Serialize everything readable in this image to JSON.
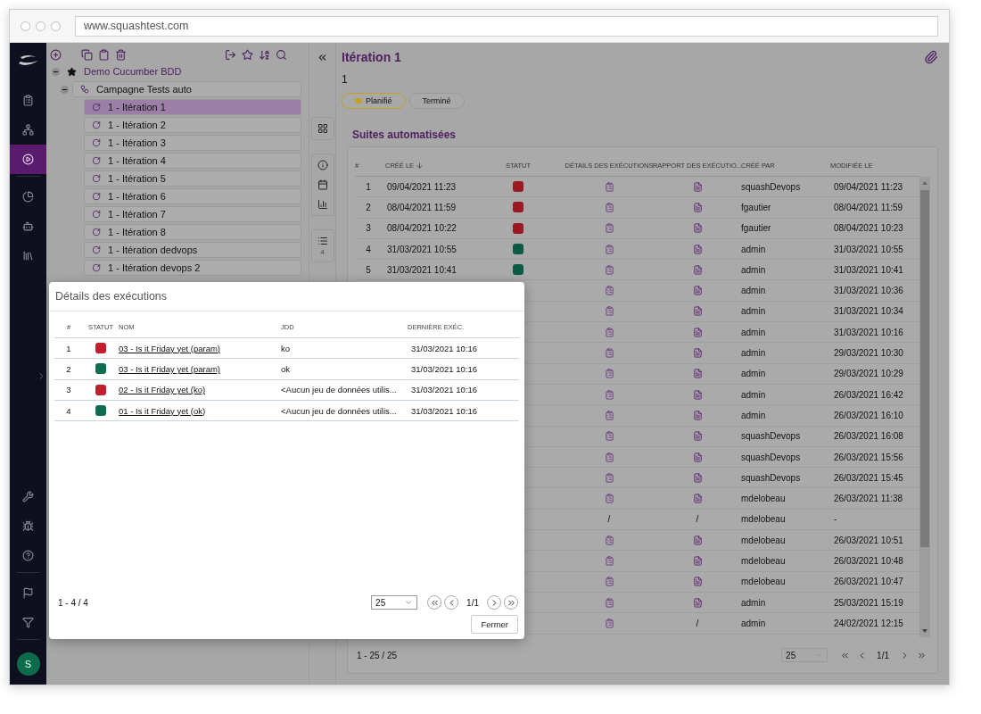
{
  "browser": {
    "url": "www.squashtest.com"
  },
  "nav": {
    "items": [
      {
        "selected": false
      },
      {
        "selected": false
      },
      {
        "selected": true
      },
      {
        "selected": false
      },
      {
        "selected": false
      },
      {
        "selected": false
      }
    ],
    "bottom_items": [
      {
        "selected": false
      },
      {
        "selected": false
      },
      {
        "selected": false
      },
      {
        "selected": false
      },
      {
        "selected": false
      }
    ],
    "user_initial": "S"
  },
  "tree": {
    "nodes": [
      {
        "label": "Demo Cucumber BDD",
        "expanded": true,
        "selected": false,
        "children": [
          {
            "label": "Campagne Tests auto",
            "expanded": true,
            "selected": false,
            "children": [
              {
                "label": "1 - Itération 1",
                "selected": true
              },
              {
                "label": "1 - Itération 2",
                "selected": false
              },
              {
                "label": "1 - Itération 3",
                "selected": false
              },
              {
                "label": "1 - Itération 4",
                "selected": false
              },
              {
                "label": "1 - Itération 5",
                "selected": false
              },
              {
                "label": "1 - Itération 6",
                "selected": false
              },
              {
                "label": "1 - Itération 7",
                "selected": false
              },
              {
                "label": "1 - Itération 8",
                "selected": false
              },
              {
                "label": "1 - Itération dedvops",
                "selected": false
              },
              {
                "label": "1 - Itération devops 2",
                "selected": false
              }
            ]
          }
        ]
      }
    ]
  },
  "side_panel": {
    "list_count": "4"
  },
  "header": {
    "title": "Itération 1",
    "reference": "1",
    "statuses": [
      {
        "label": "Planifié",
        "selected": true
      },
      {
        "label": "Terminé",
        "selected": false
      }
    ]
  },
  "suites": {
    "title": "Suites automatisées",
    "columns": [
      {
        "label": "#"
      },
      {
        "label": "CRÉÉ LE",
        "sorted": true
      },
      {
        "label": "STATUT"
      },
      {
        "label": "DÉTAILS DES EXÉCUTIONS"
      },
      {
        "label": "RAPPORT DES EXÉCUTIO..."
      },
      {
        "label": "CRÉÉ PAR"
      },
      {
        "label": "MODIFIÉE LE"
      }
    ],
    "rows": [
      {
        "num": "1",
        "created": "09/04/2021 11:23",
        "color": "#9a1a24",
        "details": {
          "kind": "icon"
        },
        "report": {
          "kind": "icon"
        },
        "author": "squashDevops",
        "modified": "09/04/2021 11:23"
      },
      {
        "num": "2",
        "created": "08/04/2021 11:59",
        "color": "#9a1a24",
        "details": {
          "kind": "icon"
        },
        "report": {
          "kind": "icon"
        },
        "author": "fgautier",
        "modified": "08/04/2021 11:59"
      },
      {
        "num": "3",
        "created": "08/04/2021 10:22",
        "color": "#9a1a24",
        "details": {
          "kind": "icon"
        },
        "report": {
          "kind": "icon"
        },
        "author": "fgautier",
        "modified": "08/04/2021 10:23"
      },
      {
        "num": "4",
        "created": "31/03/2021 10:55",
        "color": "#0d5a44",
        "details": {
          "kind": "icon"
        },
        "report": {
          "kind": "icon"
        },
        "author": "admin",
        "modified": "31/03/2021 10:55"
      },
      {
        "num": "5",
        "created": "31/03/2021 10:41",
        "color": "#0d5a44",
        "details": {
          "kind": "icon"
        },
        "report": {
          "kind": "icon"
        },
        "author": "admin",
        "modified": "31/03/2021 10:41"
      },
      {
        "details": {
          "kind": "icon"
        },
        "report": {
          "kind": "icon"
        },
        "author": "admin",
        "modified": "31/03/2021 10:36"
      },
      {
        "details": {
          "kind": "icon"
        },
        "report": {
          "kind": "icon"
        },
        "author": "admin",
        "modified": "31/03/2021 10:34"
      },
      {
        "details": {
          "kind": "icon"
        },
        "report": {
          "kind": "icon"
        },
        "author": "admin",
        "modified": "31/03/2021 10:16"
      },
      {
        "details": {
          "kind": "icon"
        },
        "report": {
          "kind": "icon"
        },
        "author": "admin",
        "modified": "29/03/2021 10:30"
      },
      {
        "details": {
          "kind": "icon"
        },
        "report": {
          "kind": "icon"
        },
        "author": "admin",
        "modified": "29/03/2021 10:29"
      },
      {
        "details": {
          "kind": "icon"
        },
        "report": {
          "kind": "icon"
        },
        "author": "admin",
        "modified": "26/03/2021 16:42"
      },
      {
        "details": {
          "kind": "icon"
        },
        "report": {
          "kind": "icon"
        },
        "author": "admin",
        "modified": "26/03/2021 16:10"
      },
      {
        "details": {
          "kind": "icon"
        },
        "report": {
          "kind": "icon"
        },
        "author": "squashDevops",
        "modified": "26/03/2021 16:08"
      },
      {
        "details": {
          "kind": "icon"
        },
        "report": {
          "kind": "icon"
        },
        "author": "squashDevops",
        "modified": "26/03/2021 15:56"
      },
      {
        "details": {
          "kind": "icon"
        },
        "report": {
          "kind": "icon"
        },
        "author": "squashDevops",
        "modified": "26/03/2021 15:45"
      },
      {
        "details": {
          "kind": "icon"
        },
        "report": {
          "kind": "icon"
        },
        "author": "mdelobeau",
        "modified": "26/03/2021 11:38"
      },
      {
        "details": {
          "kind": "text",
          "text": "/"
        },
        "report": {
          "kind": "text",
          "text": "/"
        },
        "author": "mdelobeau",
        "modified": "-"
      },
      {
        "details": {
          "kind": "icon"
        },
        "report": {
          "kind": "icon"
        },
        "author": "mdelobeau",
        "modified": "26/03/2021 10:51"
      },
      {
        "details": {
          "kind": "icon"
        },
        "report": {
          "kind": "icon"
        },
        "author": "mdelobeau",
        "modified": "26/03/2021 10:48"
      },
      {
        "details": {
          "kind": "icon"
        },
        "report": {
          "kind": "icon"
        },
        "author": "mdelobeau",
        "modified": "26/03/2021 10:47"
      },
      {
        "details": {
          "kind": "icon"
        },
        "report": {
          "kind": "icon"
        },
        "author": "admin",
        "modified": "25/03/2021 15:19"
      },
      {
        "details": {
          "kind": "icon"
        },
        "report": {
          "kind": "text",
          "text": "/"
        },
        "author": "admin",
        "modified": "24/02/2021 12:15"
      }
    ],
    "pagination": {
      "range": "1 - 25 / 25",
      "page_size": "25",
      "page": "1/1"
    }
  },
  "dialog": {
    "title": "Détails des exécutions",
    "columns": [
      {
        "label": "#"
      },
      {
        "label": "STATUT"
      },
      {
        "label": "NOM"
      },
      {
        "label": "JDD"
      },
      {
        "label": "DERNIÈRE EXÉC."
      }
    ],
    "rows": [
      {
        "num": "1",
        "color": "#c41e2e",
        "name": "03 - Is it Friday yet (param)",
        "dataset": "ko",
        "last": "31/03/2021 10:16"
      },
      {
        "num": "2",
        "color": "#0b6e50",
        "name": "03 - Is it Friday yet (param)",
        "dataset": "ok",
        "last": "31/03/2021 10:16"
      },
      {
        "num": "3",
        "color": "#c41e2e",
        "name": "02 - Is it Friday yet (ko)",
        "dataset": "<Aucun jeu de données utilis...",
        "last": "31/03/2021 10:16"
      },
      {
        "num": "4",
        "color": "#0b6e50",
        "name": "01 - Is it Friday yet (ok)",
        "dataset": "<Aucun jeu de données utilis...",
        "last": "31/03/2021 10:16"
      }
    ],
    "pagination": {
      "range": "1 - 4 / 4",
      "page_size": "25",
      "page": "1/1"
    },
    "close_label": "Fermer"
  }
}
